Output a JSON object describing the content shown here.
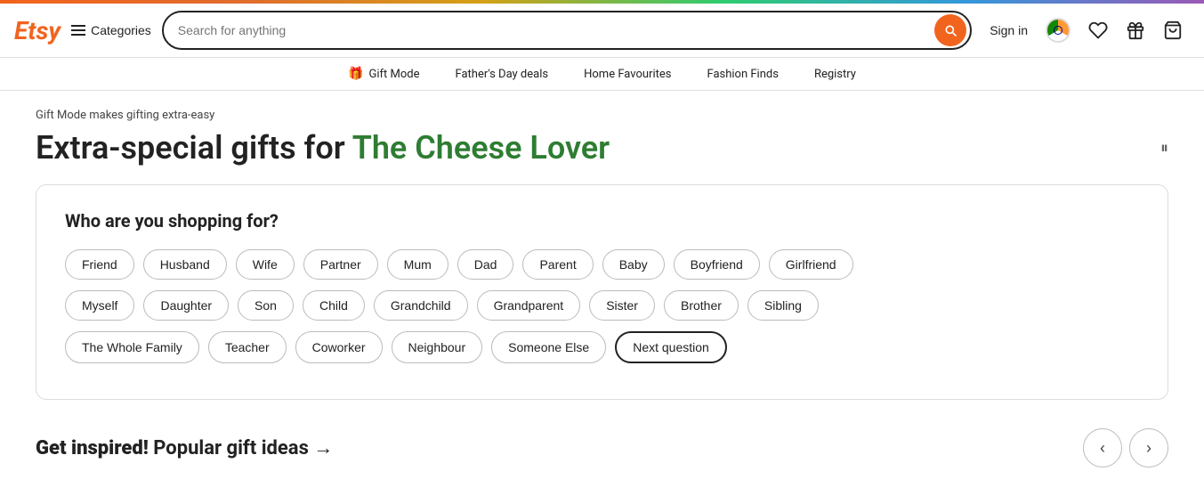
{
  "topBar": {},
  "header": {
    "logo": "Etsy",
    "categories_label": "Categories",
    "search_placeholder": "Search for anything",
    "sign_in": "Sign in"
  },
  "nav": {
    "items": [
      {
        "label": "Gift Mode",
        "icon": "🎁"
      },
      {
        "label": "Father's Day deals",
        "icon": ""
      },
      {
        "label": "Home Favourites",
        "icon": ""
      },
      {
        "label": "Fashion Finds",
        "icon": ""
      },
      {
        "label": "Registry",
        "icon": ""
      }
    ]
  },
  "main": {
    "gift_mode_label": "Gift Mode makes gifting extra-easy",
    "headline_prefix": "Extra-special gifts for ",
    "headline_dynamic": "The Cheese Lover",
    "shopping_card": {
      "question": "Who are you shopping for?",
      "tags_row1": [
        "Friend",
        "Husband",
        "Wife",
        "Partner",
        "Mum",
        "Dad",
        "Parent",
        "Baby",
        "Boyfriend",
        "Girlfriend"
      ],
      "tags_row2": [
        "Myself",
        "Daughter",
        "Son",
        "Child",
        "Grandchild",
        "Grandparent",
        "Sister",
        "Brother",
        "Sibling"
      ],
      "tags_row3": [
        "The Whole Family",
        "Teacher",
        "Coworker",
        "Neighbour",
        "Someone Else"
      ],
      "next_button": "Next question"
    },
    "popular_section": {
      "label_1": "Get inspired!",
      "label_2": "Popular gift ideas",
      "arrow": "→"
    }
  }
}
